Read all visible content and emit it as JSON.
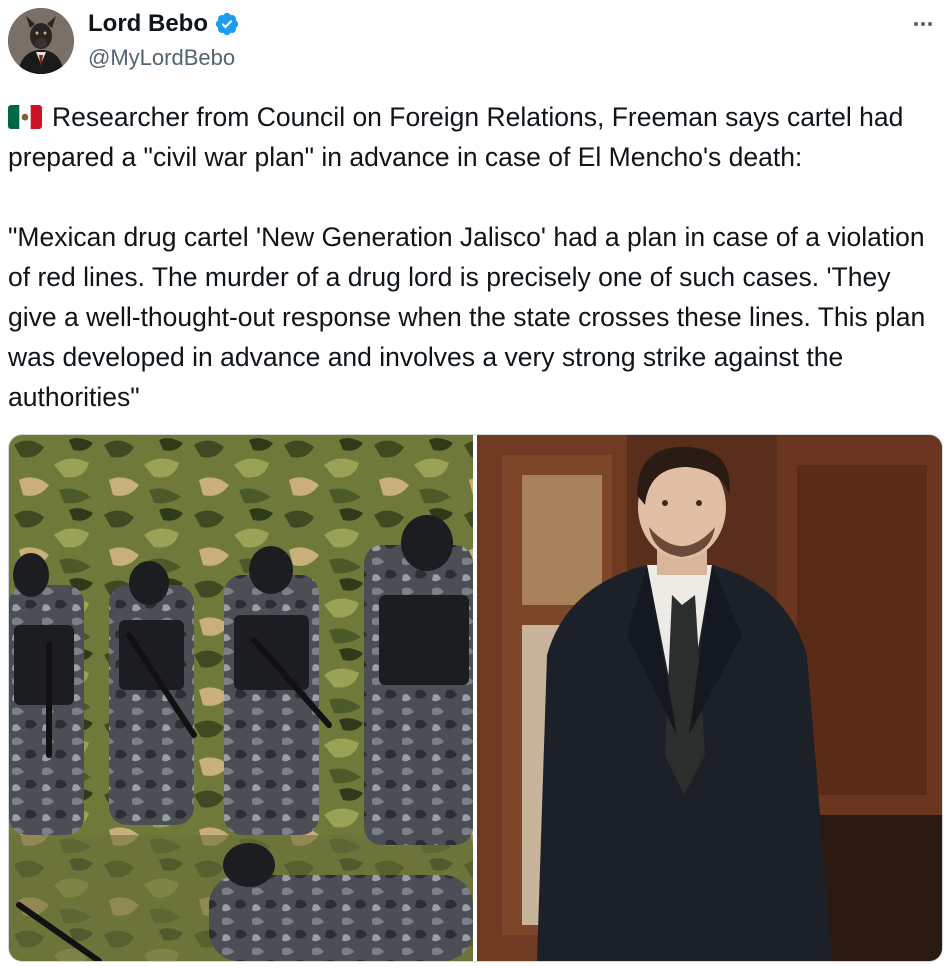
{
  "tweet": {
    "author_name": "Lord Bebo",
    "author_handle": "@MyLordBebo",
    "paragraph_1": "Researcher from Council on Foreign Relations, Freeman says cartel had prepared a \"civil war plan\" in advance in case of El Mencho's death:",
    "paragraph_2": "\"Mexican drug cartel 'New Generation Jalisco' had a plan in case of a violation of red lines. The murder of a drug lord is precisely one of such cases. 'They give a well-thought-out response when the state crosses these lines. This plan was developed in advance and involves a very strong strike against the authorities\"",
    "flag_icon": "mexico-flag-icon",
    "verified_icon": "verified-badge-icon",
    "more_icon": "more-options-icon"
  },
  "colors": {
    "verified": "#1d9bf0",
    "text": "#0f1419",
    "secondary": "#536471"
  }
}
